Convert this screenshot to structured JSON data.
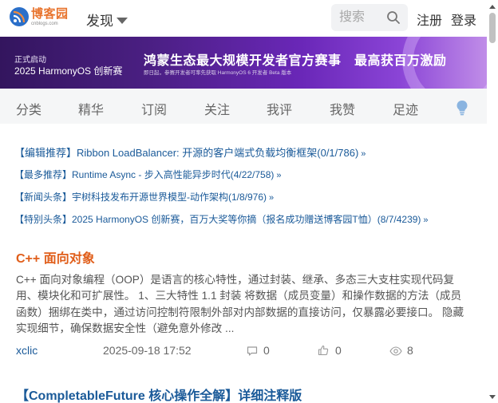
{
  "header": {
    "logo_cn": "博客园",
    "logo_en": "cnblogs.com",
    "discover_label": "发现",
    "search_placeholder": "搜索",
    "register_label": "注册",
    "login_label": "登录"
  },
  "banner": {
    "tag": "正式启动",
    "edition": "2025 HarmonyOS 创新赛",
    "headline": "鸿蒙生态最大规模开发者官方赛事　最高获百万激励",
    "subtext": "即日起，参赛开发者可率先获取 HarmonyOS 6 开发者 Beta 版本"
  },
  "nav": {
    "items": [
      "分类",
      "精华",
      "订阅",
      "关注",
      "我评",
      "我赞",
      "足迹"
    ]
  },
  "headlines": [
    {
      "text": "【编辑推荐】Ribbon LoadBalancer: 开源的客户端式负载均衡框架(0/1/786)",
      "arrow": "»"
    },
    {
      "text": "【最多推荐】Runtime Async - 步入高性能异步时代(4/22/758)",
      "arrow": "»"
    },
    {
      "text": "【新闻头条】宇树科技发布开源世界模型-动作架构(1/8/976)",
      "arrow": "»"
    },
    {
      "text": "【特别头条】2025 HarmonyOS 创新赛，百万大奖等你摘（报名成功赠送博客园T恤）(8/7/4239)",
      "arrow": "»"
    }
  ],
  "article": {
    "title": "C++ 面向对象",
    "summary": "C++ 面向对象编程（OOP）是语言的核心特性，通过封装、继承、多态三大支柱实现代码复用、模块化和可扩展性。 1、三大特性 1.1 封装 将数据（成员变量）和操作数据的方法（成员函数）捆绑在类中，通过访问控制符限制外部对内部数据的直接访问，仅暴露必要接口。 隐藏实现细节，确保数据安全性（避免意外修改 ...",
    "author": "xclic",
    "date": "2025-09-18 17:52",
    "comments": "0",
    "likes": "0",
    "views": "8"
  },
  "article2": {
    "title": "【CompletableFuture 核心操作全解】详细注释版"
  },
  "icons": {
    "logo": "rss-logo-icon",
    "discover_caret": "caret-down-icon",
    "search": "search-icon",
    "tips": "lightbulb-icon",
    "comments": "comment-icon",
    "likes": "thumbs-up-icon",
    "views": "eye-icon"
  },
  "colors": {
    "brand_orange": "#e8742e",
    "link_blue": "#1a5a99",
    "title_orange": "#e05e1a"
  }
}
